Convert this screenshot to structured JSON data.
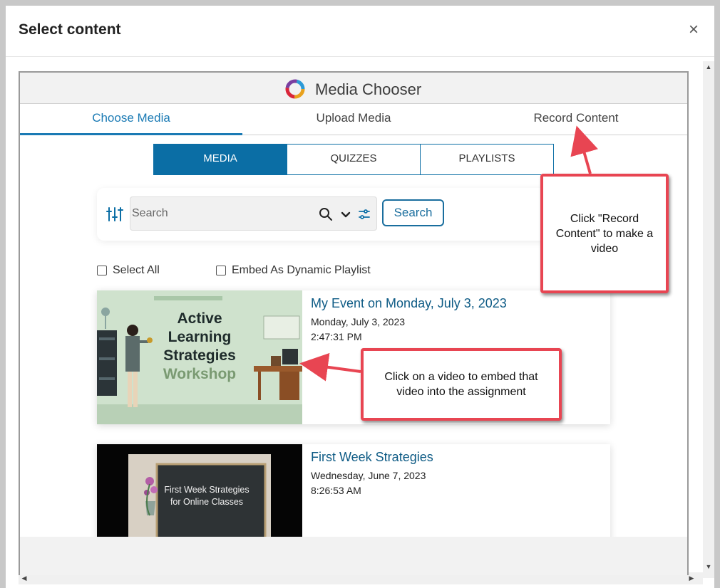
{
  "modal": {
    "title": "Select content",
    "close": "×"
  },
  "chooser": {
    "title": "Media Chooser",
    "tabs": [
      {
        "label": "Choose Media",
        "active": true
      },
      {
        "label": "Upload Media",
        "active": false
      },
      {
        "label": "Record Content",
        "active": false
      }
    ],
    "segments": [
      {
        "label": "MEDIA",
        "active": true
      },
      {
        "label": "QUIZZES",
        "active": false
      },
      {
        "label": "PLAYLISTS",
        "active": false
      }
    ],
    "search": {
      "placeholder": "Search",
      "button_label": "Search"
    },
    "checkboxes": {
      "select_all": "Select All",
      "embed_dynamic": "Embed As Dynamic Playlist"
    },
    "items": [
      {
        "title": "My Event on Monday, July 3, 2023",
        "date": "Monday, July 3, 2023",
        "time": "2:47:31 PM",
        "thumb_text": [
          "Active",
          "Learning",
          "Strategies",
          "Workshop"
        ]
      },
      {
        "title": "First Week Strategies",
        "date": "Wednesday, June 7, 2023",
        "time": "8:26:53 AM",
        "thumb_text": [
          "First Week Strategies",
          "for Online Classes"
        ]
      }
    ]
  },
  "callouts": {
    "record": "Click \"Record Content\" to make a video",
    "video": "Click on a video to embed that video into the assignment"
  },
  "colors": {
    "accent": "#0b6ea5",
    "callout_border": "#e84552",
    "link_title": "#0e5b85"
  },
  "icons": [
    "close-icon",
    "media-chooser-logo",
    "filter-sliders-icon",
    "search-icon",
    "chevron-down-icon",
    "settings-sliders-icon"
  ]
}
